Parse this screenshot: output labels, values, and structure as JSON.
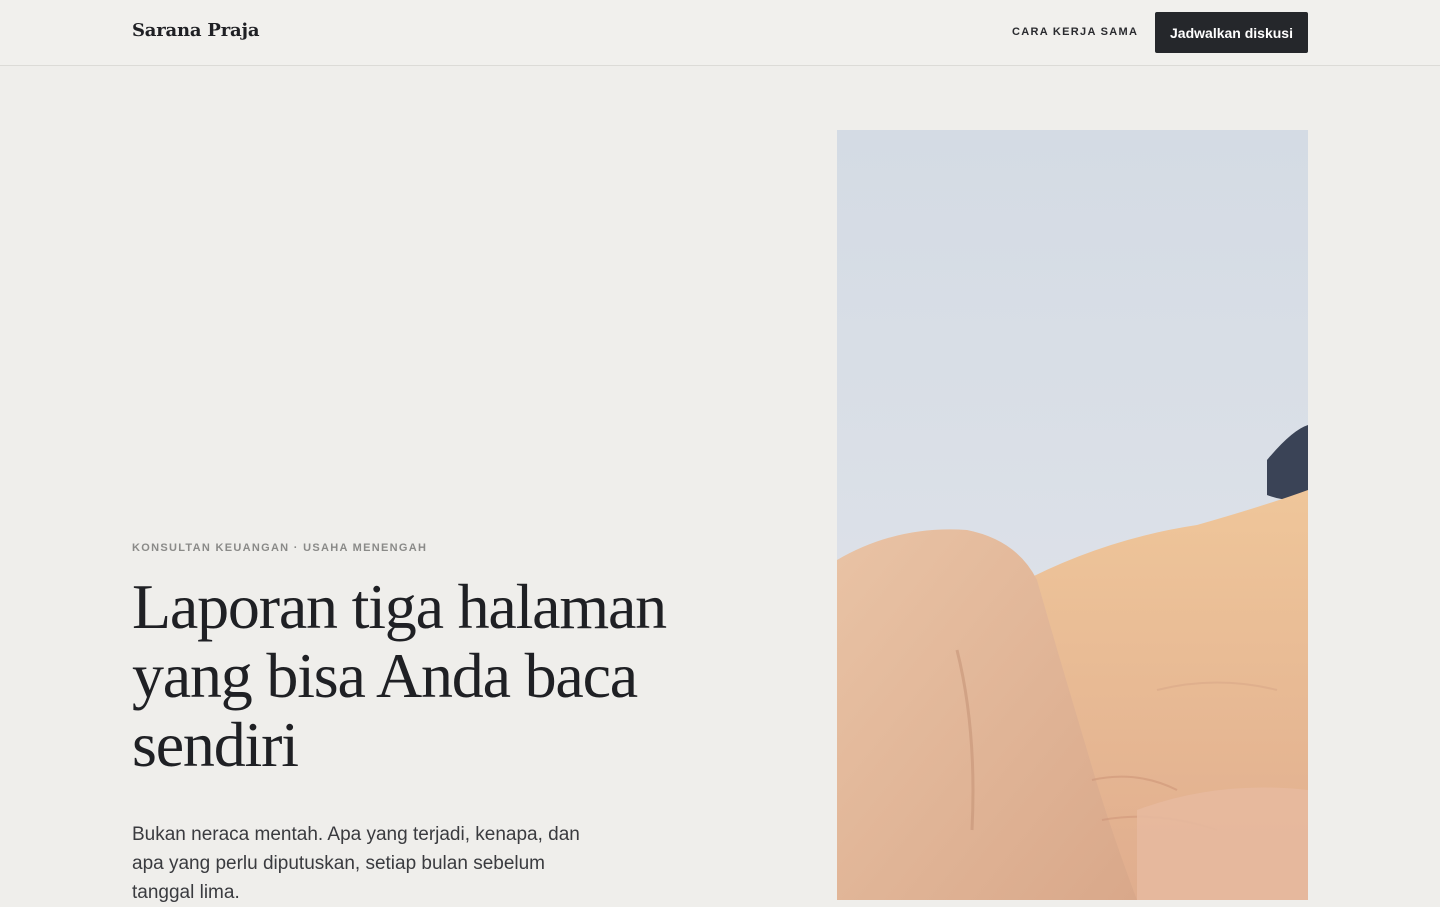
{
  "header": {
    "brand": "Sarana Praja",
    "nav_link": "CARA KERJA SAMA",
    "cta_label": "Jadwalkan diskusi"
  },
  "hero": {
    "eyebrow": "KONSULTAN KEUANGAN · USAHA MENENGAH",
    "title": "Laporan tiga halaman yang bisa Anda baca sendiri",
    "lead": "Bukan neraca mentah. Apa yang terjadi, kenapa, dan apa yang perlu diputuskan, setiap bulan sebelum tanggal lima.",
    "image_subject": "handshake-photo"
  },
  "colors": {
    "background": "#efeeeb",
    "text": "#1f2024",
    "button": "#25272b",
    "muted": "#8a8a88"
  }
}
